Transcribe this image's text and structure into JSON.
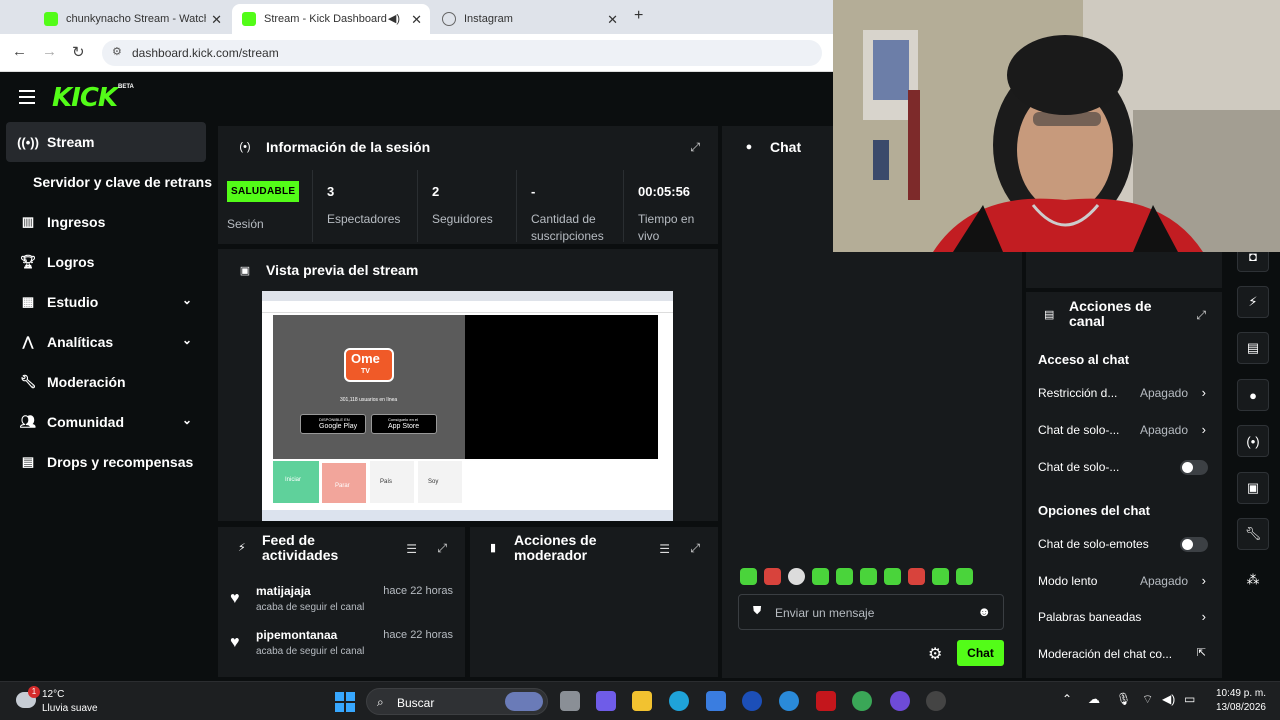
{
  "browser": {
    "tabs": [
      {
        "label": "chunkynacho Stream - Watch Li",
        "icon": "kick-icon"
      },
      {
        "label": "Stream - Kick Dashboard",
        "icon": "kick-icon",
        "active": true
      },
      {
        "label": "Instagram",
        "icon": "globe-icon"
      }
    ],
    "close_glyph": "✕",
    "new_tab_glyph": "+",
    "url": "dashboard.kick.com/stream"
  },
  "header": {
    "logo": "KICK",
    "beta": "BETA"
  },
  "sidebar": {
    "items": [
      {
        "label": "Stream",
        "icon": "broadcast-icon",
        "active": true
      },
      {
        "label": "Servidor y clave de retransmisión",
        "sub": true
      },
      {
        "label": "Ingresos",
        "icon": "chart-icon"
      },
      {
        "label": "Logros",
        "icon": "trophy-icon"
      },
      {
        "label": "Estudio",
        "icon": "film-icon",
        "chevron": true
      },
      {
        "label": "Analíticas",
        "icon": "analytics-icon",
        "chevron": true
      },
      {
        "label": "Moderación",
        "icon": "wrench-icon"
      },
      {
        "label": "Comunidad",
        "icon": "people-icon",
        "chevron": true
      },
      {
        "label": "Drops y recompensas",
        "icon": "gift-icon"
      }
    ]
  },
  "session": {
    "title": "Información de la sesión",
    "status_badge": "SALUDABLE",
    "status_label": "Sesión",
    "stats": [
      {
        "value": "3",
        "label": "Espectadores"
      },
      {
        "value": "2",
        "label": "Seguidores"
      },
      {
        "value": "-",
        "label": "Cantidad de suscripciones"
      },
      {
        "value": "00:05:56",
        "label": "Tiempo en vivo"
      }
    ]
  },
  "preview": {
    "title": "Vista previa del stream",
    "screen": {
      "logo_top": "Ome",
      "logo_bottom": "TV",
      "online": "301,118 usuarios en línea",
      "google_small": "DISPONIBLE EN",
      "google": "Google Play",
      "apple_small": "Consíguelo en el",
      "apple": "App Store",
      "btn_start": "Iniciar",
      "btn_stop": "Parar",
      "btn_country": "País",
      "btn_gender": "Soy"
    }
  },
  "feed": {
    "title": "Feed de actividades",
    "items": [
      {
        "name": "matijajaja",
        "time": "hace 22 horas",
        "action": "acaba de seguir el canal"
      },
      {
        "name": "pipemontanaa",
        "time": "hace 22 horas",
        "action": "acaba de seguir el canal"
      }
    ]
  },
  "moderator": {
    "title": "Acciones de moderador"
  },
  "chat": {
    "title": "Chat",
    "placeholder": "Enviar un mensaje",
    "send_label": "Chat"
  },
  "canal": {
    "title": "Acciones de canal",
    "access_section": "Acceso al chat",
    "access_rows": [
      {
        "label": "Restricción d...",
        "value": "Apagado",
        "type": "arrow"
      },
      {
        "label": "Chat de solo-...",
        "value": "Apagado",
        "type": "arrow"
      },
      {
        "label": "Chat de solo-...",
        "type": "toggle",
        "on": false
      }
    ],
    "options_section": "Opciones del chat",
    "options_rows": [
      {
        "label": "Chat de solo-emotes",
        "type": "toggle",
        "on": false
      },
      {
        "label": "Modo lento",
        "value": "Apagado",
        "type": "arrow"
      },
      {
        "label": "Palabras baneadas",
        "type": "arrow"
      },
      {
        "label": "Moderación del chat co...",
        "type": "external"
      }
    ]
  },
  "taskbar": {
    "temperature": "12°C",
    "weather": "Lluvia suave",
    "weather_badge": "1",
    "search": "Buscar",
    "time": "10:49 p. m.",
    "date": "13/08/2026"
  },
  "colors": {
    "accent": "#53fc18",
    "panel": "#171a1c",
    "bg": "#0b0e0f"
  }
}
